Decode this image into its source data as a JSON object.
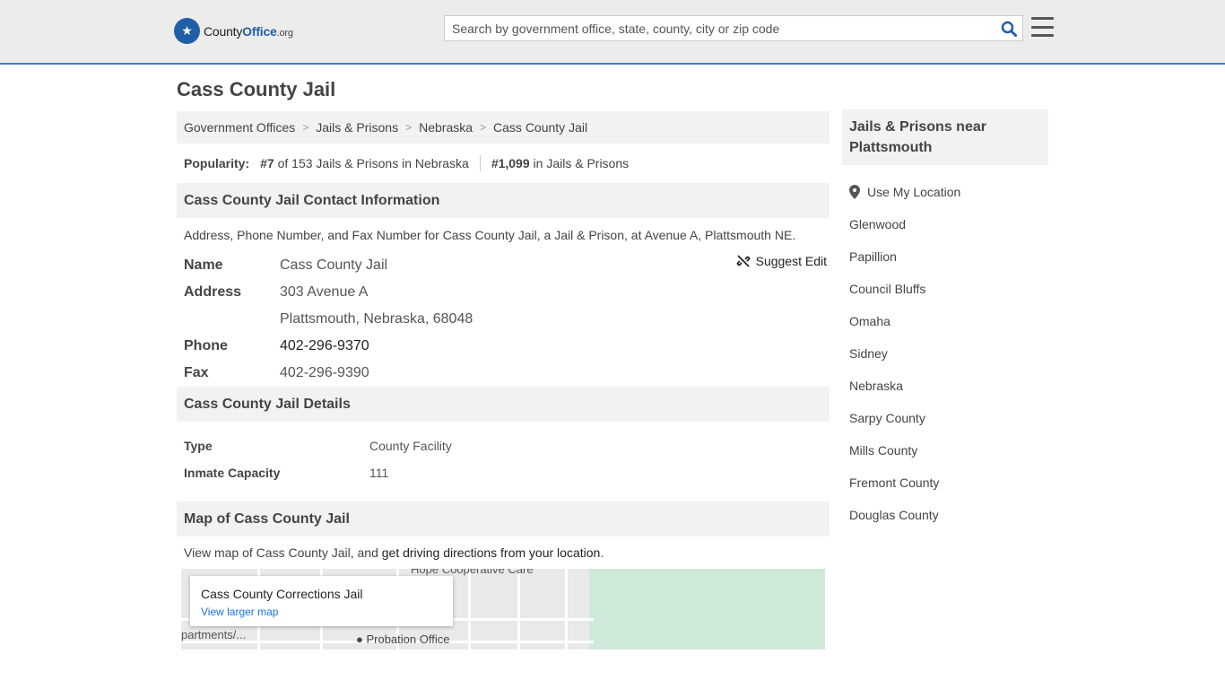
{
  "header": {
    "logo": {
      "brand_a": "County",
      "brand_b": "Office",
      "brand_c": ".org"
    },
    "search_placeholder": "Search by government office, state, county, city or zip code"
  },
  "page_title": "Cass County Jail",
  "breadcrumb": [
    "Government Offices",
    "Jails & Prisons",
    "Nebraska",
    "Cass County Jail"
  ],
  "popularity": {
    "label": "Popularity:",
    "rank_state": "#7",
    "rank_state_text": "of 153 Jails & Prisons in Nebraska",
    "rank_national": "#1,099",
    "rank_national_text": "in Jails & Prisons"
  },
  "contact": {
    "heading": "Cass County Jail Contact Information",
    "description": "Address, Phone Number, and Fax Number for Cass County Jail, a Jail & Prison, at Avenue A, Plattsmouth NE.",
    "suggest_edit": "Suggest Edit",
    "name_label": "Name",
    "name": "Cass County Jail",
    "address_label": "Address",
    "address_line1": "303 Avenue A",
    "address_line2": "Plattsmouth, Nebraska, 68048",
    "phone_label": "Phone",
    "phone": "402-296-9370",
    "fax_label": "Fax",
    "fax": "402-296-9390"
  },
  "details": {
    "heading": "Cass County Jail Details",
    "type_label": "Type",
    "type": "County Facility",
    "capacity_label": "Inmate Capacity",
    "capacity": "111"
  },
  "map": {
    "heading": "Map of Cass County Jail",
    "desc_prefix": "View map of Cass County Jail, and ",
    "desc_link": "get driving directions from your location",
    "desc_suffix": ".",
    "infobox_title": "Cass County Corrections Jail",
    "infobox_link": "View larger map",
    "label_probation": "Probation Office",
    "label_hope": "Hope Cooperative Care",
    "label_apartments": "partments/..."
  },
  "aside": {
    "heading": "Jails & Prisons near Plattsmouth",
    "use_location": "Use My Location",
    "items": [
      "Glenwood",
      "Papillion",
      "Council Bluffs",
      "Omaha",
      "Sidney",
      "Nebraska",
      "Sarpy County",
      "Mills County",
      "Fremont County",
      "Douglas County"
    ]
  }
}
